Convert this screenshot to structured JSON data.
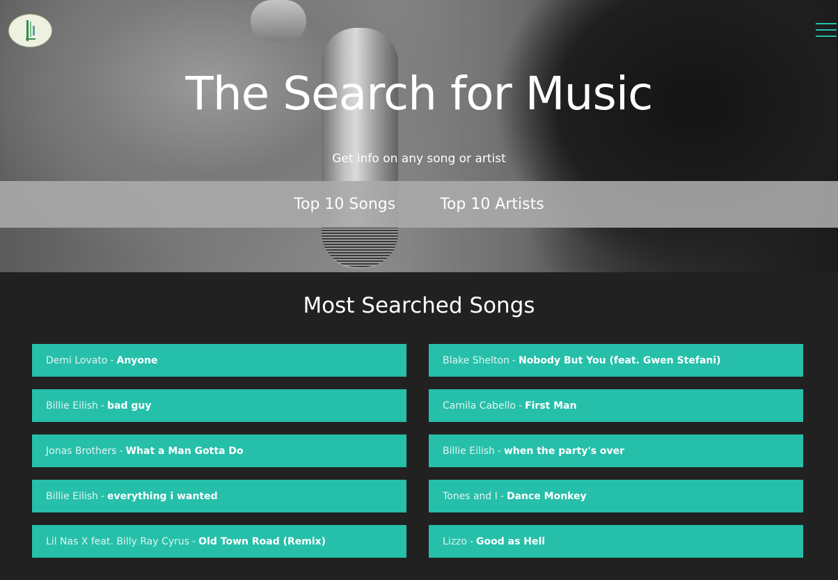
{
  "hero": {
    "title": "The Search for Music",
    "subtitle": "Get info on any song or artist"
  },
  "nav": {
    "links": [
      {
        "label": "Top 10 Songs"
      },
      {
        "label": "Top 10 Artists"
      }
    ]
  },
  "section": {
    "title": "Most Searched Songs"
  },
  "songs": [
    {
      "artist": "Demi Lovato",
      "separator": "-",
      "title": "Anyone"
    },
    {
      "artist": "Blake Shelton",
      "separator": "-",
      "title": "Nobody But You (feat. Gwen Stefani)"
    },
    {
      "artist": "Billie Eilish",
      "separator": "-",
      "title": "bad guy"
    },
    {
      "artist": "Camila Cabello",
      "separator": "-",
      "title": "First Man"
    },
    {
      "artist": "Jonas Brothers",
      "separator": "-",
      "title": "What a Man Gotta Do"
    },
    {
      "artist": "Billie Eilish",
      "separator": "-",
      "title": "when the party's over"
    },
    {
      "artist": "Billie Eilish",
      "separator": "-",
      "title": "everything i wanted"
    },
    {
      "artist": "Tones and I",
      "separator": "-",
      "title": "Dance Monkey"
    },
    {
      "artist": "Lil Nas X feat. Billy Ray Cyrus",
      "separator": "-",
      "title": "Old Town Road (Remix)"
    },
    {
      "artist": "Lizzo",
      "separator": "-",
      "title": "Good as Hell"
    }
  ],
  "icons": {
    "logo": "logo-icon",
    "menu": "hamburger-menu-icon"
  },
  "colors": {
    "accent": "#26bfaa",
    "page_background": "#212121",
    "nav_band": "#aaaaaa"
  }
}
